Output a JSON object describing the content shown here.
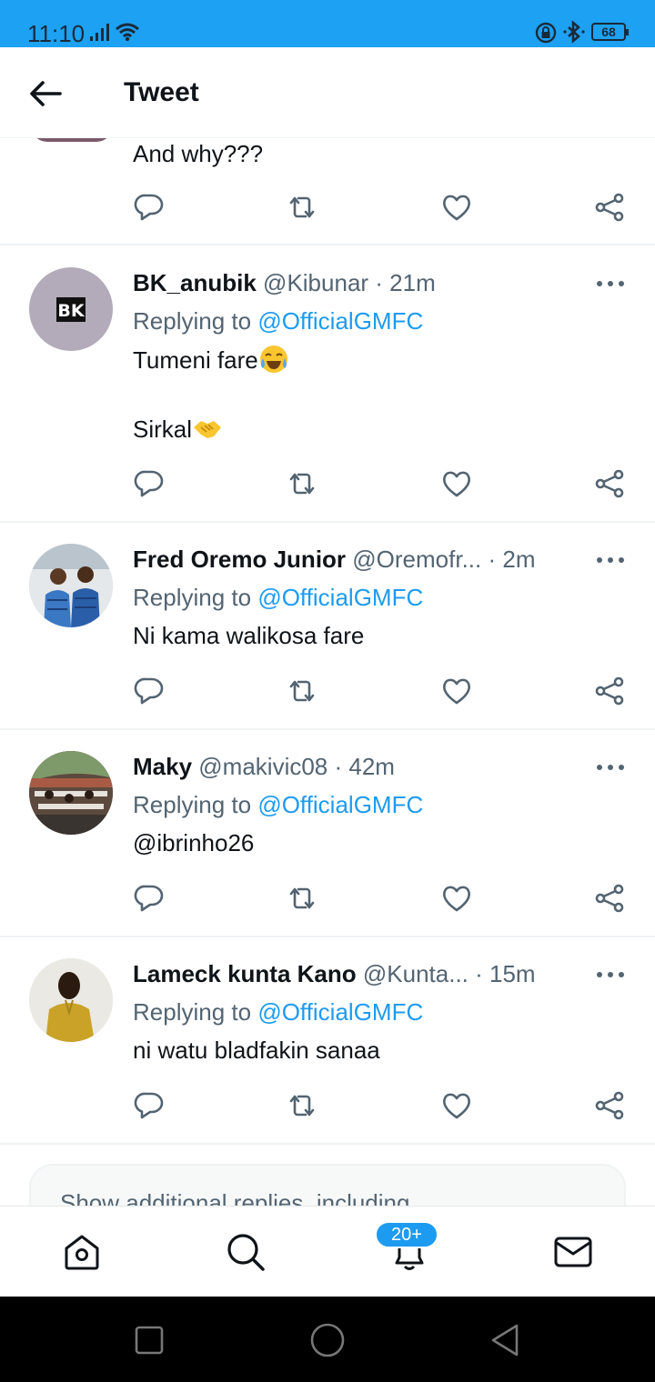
{
  "status_bar": {
    "time": "11:10",
    "battery": "68"
  },
  "header": {
    "title": "Tweet"
  },
  "top_tweet": {
    "text": "And why???"
  },
  "tweets": [
    {
      "name": "BK_anubik",
      "handle": "@Kibunar",
      "time": "· 21m",
      "replying_prefix": "Replying to ",
      "replying_to": "@OfficialGMFC",
      "lines": [
        "Tumeni fare",
        "Sirkal"
      ],
      "avatar_text": "BK"
    },
    {
      "name": "Fred Oremo Junior",
      "handle": "@Oremofr...",
      "time": "· 2m",
      "replying_prefix": "Replying to ",
      "replying_to": "@OfficialGMFC",
      "lines": [
        "Ni kama walikosa fare"
      ]
    },
    {
      "name": "Maky",
      "handle": "@makivic08",
      "time": "· 42m",
      "replying_prefix": "Replying to ",
      "replying_to": "@OfficialGMFC",
      "lines": [
        "@ibrinho26"
      ]
    },
    {
      "name": "Lameck kunta Kano",
      "handle": "@Kunta...",
      "time": "· 15m",
      "replying_prefix": "Replying to ",
      "replying_to": "@OfficialGMFC",
      "lines": [
        "ni watu bladfakin sanaa"
      ]
    }
  ],
  "more_replies": {
    "text": "Show additional replies, including"
  },
  "bottom_nav": {
    "badge": "20+"
  },
  "colors": {
    "accent": "#1d9bf0",
    "status_bar": "#1da1f2",
    "secondary_text": "#536471"
  }
}
